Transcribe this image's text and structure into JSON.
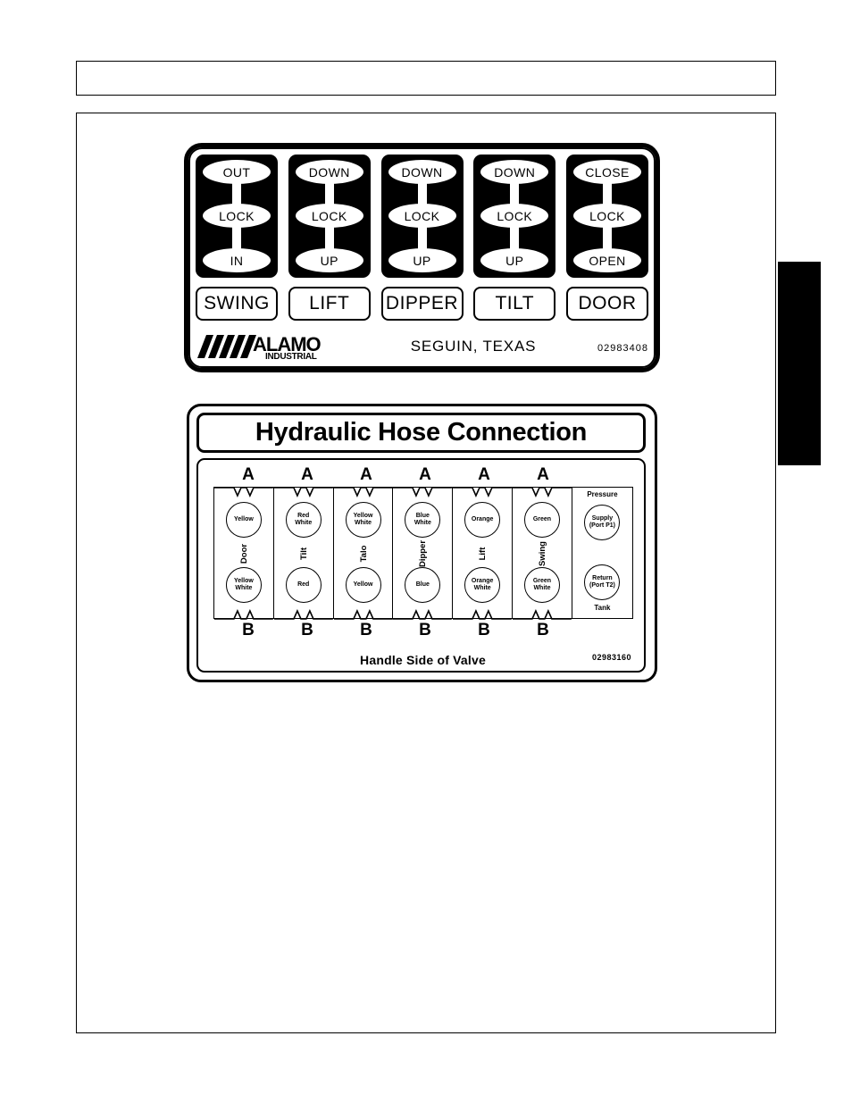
{
  "page": {
    "header_text": "",
    "edge_tab_color": "#000000"
  },
  "switch_decal": {
    "part_number": "02983408",
    "manufacturer": "ALAMO",
    "manufacturer_sub": "INDUSTRIAL",
    "city_state": "SEGUIN, TEXAS",
    "switches": [
      {
        "top": "OUT",
        "middle": "LOCK",
        "bottom": "IN",
        "name": "SWING"
      },
      {
        "top": "DOWN",
        "middle": "LOCK",
        "bottom": "UP",
        "name": "LIFT"
      },
      {
        "top": "DOWN",
        "middle": "LOCK",
        "bottom": "UP",
        "name": "DIPPER"
      },
      {
        "top": "DOWN",
        "middle": "LOCK",
        "bottom": "UP",
        "name": "TILT"
      },
      {
        "top": "CLOSE",
        "middle": "LOCK",
        "bottom": "OPEN",
        "name": "DOOR"
      }
    ]
  },
  "hose_decal": {
    "title": "Hydraulic Hose Connection",
    "footer": "Handle Side of Valve",
    "part_number": "02983160",
    "port_a_label": "A",
    "port_b_label": "B",
    "columns": [
      {
        "function": "Door",
        "a_port": [
          "Yellow"
        ],
        "b_port": [
          "Yellow",
          "White"
        ]
      },
      {
        "function": "Tilt",
        "a_port": [
          "Red",
          "White"
        ],
        "b_port": [
          "Red"
        ]
      },
      {
        "function": "Talo",
        "a_port": [
          "Yellow",
          "White"
        ],
        "b_port": [
          "Yellow"
        ]
      },
      {
        "function": "Dipper",
        "a_port": [
          "Blue",
          "White"
        ],
        "b_port": [
          "Blue"
        ]
      },
      {
        "function": "Lift",
        "a_port": [
          "Orange"
        ],
        "b_port": [
          "Orange",
          "White"
        ]
      },
      {
        "function": "Swing",
        "a_port": [
          "Green"
        ],
        "b_port": [
          "Green",
          "White"
        ]
      }
    ],
    "tank_column": {
      "top_caption": "Pressure",
      "supply": [
        "Supply",
        "(Port P1)"
      ],
      "return": [
        "Return",
        "(Port T2)"
      ],
      "bottom_caption": "Tank"
    }
  }
}
